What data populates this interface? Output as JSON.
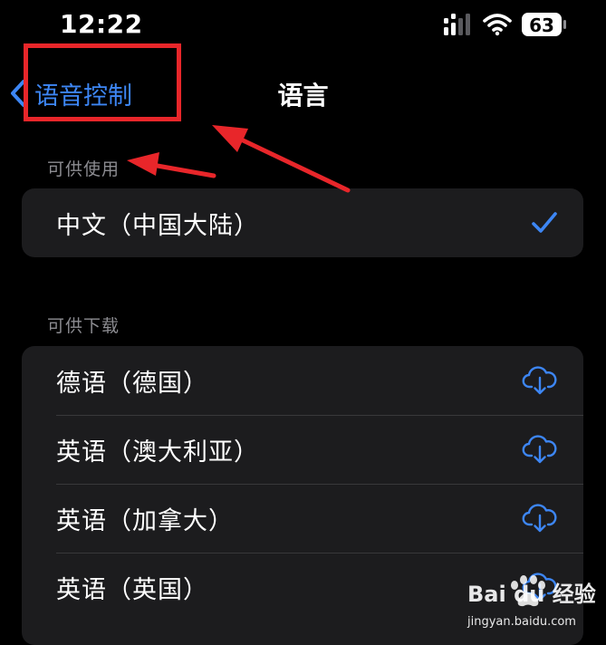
{
  "status_bar": {
    "time": "12:22",
    "battery_level": "63",
    "icons": [
      "cellular-signal-icon",
      "wifi-icon",
      "battery-icon"
    ]
  },
  "nav": {
    "back_label": "语音控制",
    "title": "语言"
  },
  "available": {
    "header": "可供使用",
    "items": [
      {
        "label": "中文（中国大陆）",
        "selected": true,
        "trailing_icon": "checkmark-icon"
      }
    ]
  },
  "downloadable": {
    "header": "可供下载",
    "items": [
      {
        "label": "德语（德国）",
        "trailing_icon": "cloud-download-icon"
      },
      {
        "label": "英语（澳大利亚）",
        "trailing_icon": "cloud-download-icon"
      },
      {
        "label": "英语（加拿大）",
        "trailing_icon": "cloud-download-icon"
      },
      {
        "label": "英语（英国）",
        "trailing_icon": "cloud-download-icon"
      }
    ]
  },
  "colors": {
    "accent": "#3d86f4",
    "annotation": "#e8262a",
    "background": "#000000",
    "cell": "#1c1c1e",
    "section_header": "#8c8c91"
  },
  "watermark": {
    "brand": "Bai du 经验",
    "url": "jingyan.baidu.com"
  }
}
